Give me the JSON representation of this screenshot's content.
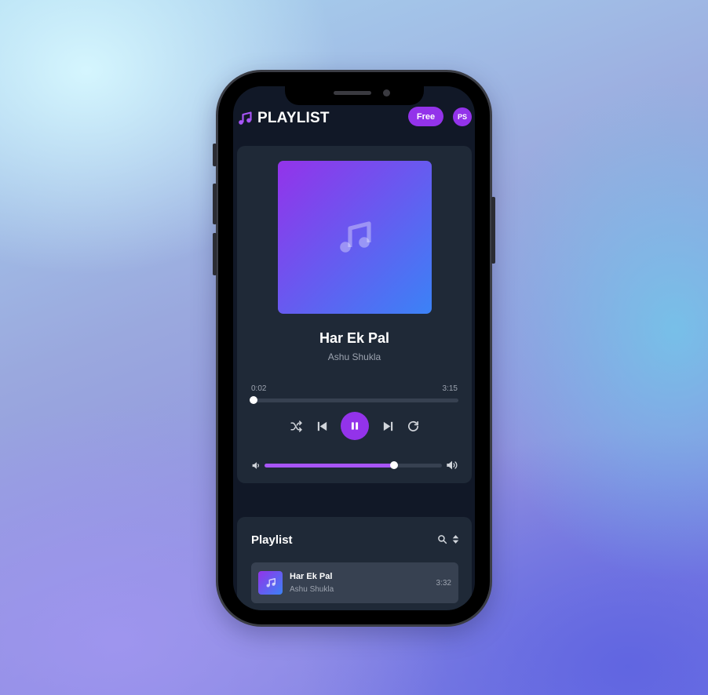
{
  "app": {
    "logo_text": "PLAYLIST",
    "plan_label": "Free",
    "user_initials": "PS"
  },
  "player": {
    "title": "Har Ek Pal",
    "artist": "Ashu Shukla",
    "current_time": "0:02",
    "duration": "3:15",
    "progress_fraction": 0.01,
    "volume_fraction": 0.73,
    "state": "playing"
  },
  "controls": [
    "shuffle-icon",
    "previous-icon",
    "pause-icon",
    "next-icon",
    "repeat-icon"
  ],
  "playlist": {
    "title": "Playlist",
    "tracks": [
      {
        "title": "Har Ek Pal",
        "artist": "Ashu Shukla",
        "duration": "3:32"
      }
    ]
  },
  "colors": {
    "accent": "#9333ea",
    "card": "#1f2937",
    "screen": "#111827",
    "track_row": "#374151"
  }
}
